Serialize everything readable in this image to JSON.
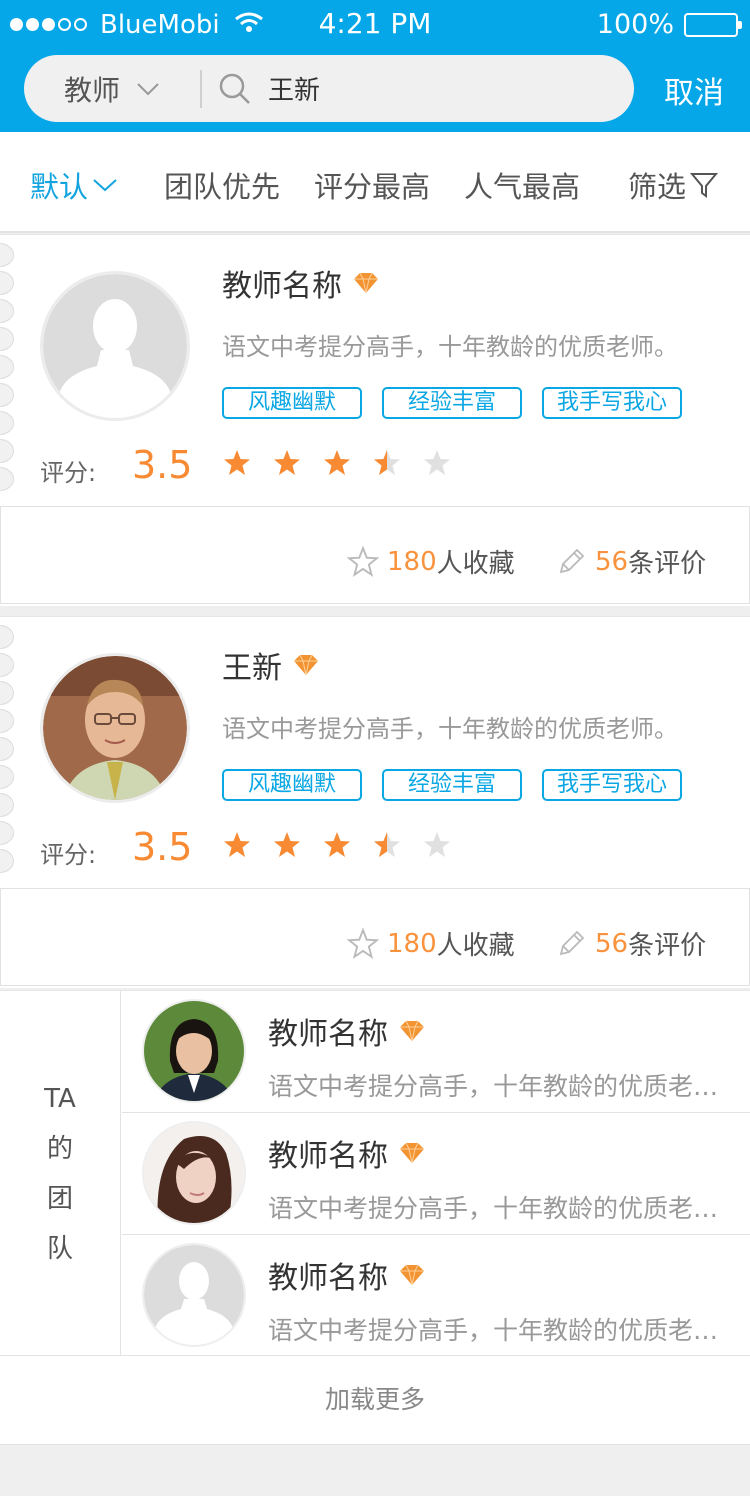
{
  "status_bar": {
    "carrier": "BlueMobi",
    "time": "4:21 PM",
    "battery": "100%"
  },
  "search": {
    "type_label": "教师",
    "query": "王新",
    "cancel_label": "取消"
  },
  "filters": [
    {
      "label": "默认",
      "active": true
    },
    {
      "label": "团队优先"
    },
    {
      "label": "评分最高"
    },
    {
      "label": "人气最高"
    },
    {
      "label": "筛选"
    }
  ],
  "teachers": [
    {
      "name": "教师名称",
      "description": "语文中考提分高手，十年教龄的优质老师。",
      "tags": [
        "风趣幽默",
        "经验丰富",
        "我手写我心"
      ],
      "rating_label": "评分:",
      "rating_value": "3.5",
      "stars": 3.5,
      "favorites_count": "180",
      "favorites_suffix": "人收藏",
      "reviews_count": "56",
      "reviews_suffix": "条评价"
    },
    {
      "name": "王新",
      "description": "语文中考提分高手，十年教龄的优质老师。",
      "tags": [
        "风趣幽默",
        "经验丰富",
        "我手写我心"
      ],
      "rating_label": "评分:",
      "rating_value": "3.5",
      "stars": 3.5,
      "favorites_count": "180",
      "favorites_suffix": "人收藏",
      "reviews_count": "56",
      "reviews_suffix": "条评价"
    }
  ],
  "team": {
    "title_lines": [
      "TA",
      "的",
      "团",
      "队"
    ],
    "members": [
      {
        "name": "教师名称",
        "description": "语文中考提分高手，十年教龄的优质老师。"
      },
      {
        "name": "教师名称",
        "description": "语文中考提分高手，十年教龄的优质老师。"
      },
      {
        "name": "教师名称",
        "description": "语文中考提分高手，十年教龄的优质老师。"
      }
    ]
  },
  "load_more": "加载更多",
  "colors": {
    "header_blue": "#05a7e8",
    "accent_orange": "#f88a33",
    "tag_blue": "#0aa7e4"
  }
}
